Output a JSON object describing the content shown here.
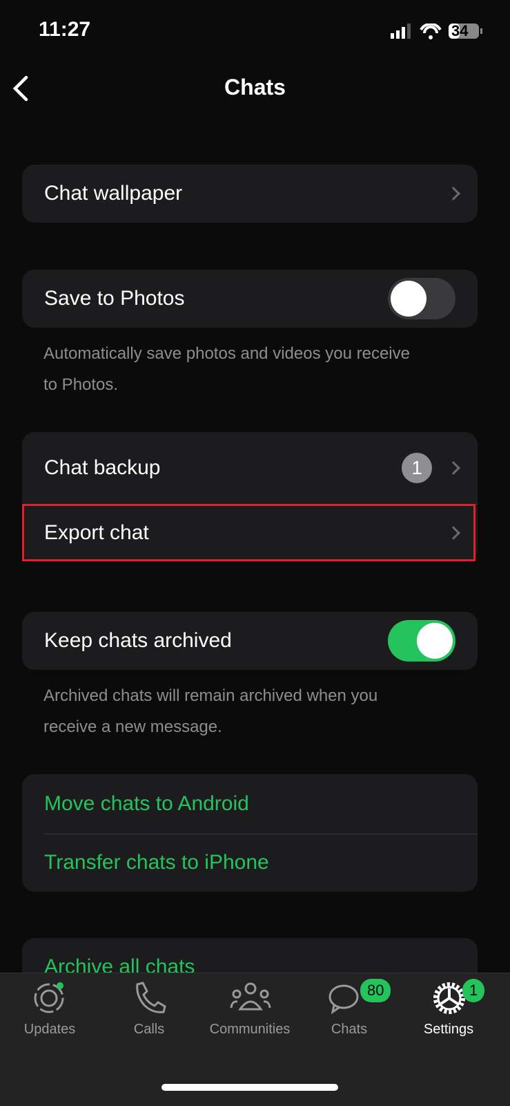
{
  "status": {
    "time": "11:27",
    "battery": "34"
  },
  "header": {
    "title": "Chats"
  },
  "settings": {
    "chat_wallpaper": "Chat wallpaper",
    "save_to_photos": {
      "label": "Save to Photos",
      "on": false,
      "footnote_1": "Automatically save photos and videos you receive",
      "footnote_2": "to Photos."
    },
    "chat_backup": {
      "label": "Chat backup",
      "badge": "1"
    },
    "export_chat": "Export chat",
    "keep_archived": {
      "label": "Keep chats archived",
      "on": true,
      "footnote_1": "Archived chats will remain archived when you",
      "footnote_2": "receive a new message."
    },
    "move_android": "Move chats to Android",
    "transfer_iphone": "Transfer chats to iPhone",
    "archive_all": "Archive all chats"
  },
  "tabs": [
    {
      "label": "Updates",
      "icon": "updates-icon"
    },
    {
      "label": "Calls",
      "icon": "phone-icon"
    },
    {
      "label": "Communities",
      "icon": "communities-icon"
    },
    {
      "label": "Chats",
      "icon": "chat-bubbles-icon",
      "badge": "80"
    },
    {
      "label": "Settings",
      "icon": "gear-icon",
      "badge": "1",
      "active": true
    }
  ],
  "colors": {
    "accent": "#25c35c",
    "highlight": "#e0212b",
    "card": "#1c1c1e"
  }
}
